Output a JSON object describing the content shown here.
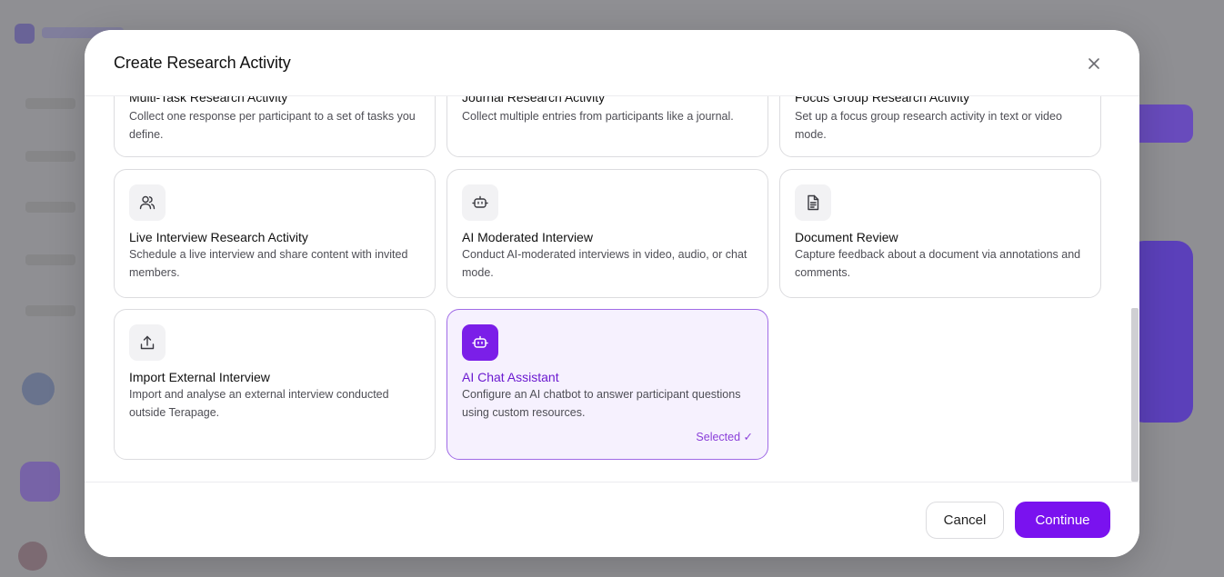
{
  "modal": {
    "title": "Create Research Activity"
  },
  "activities": [
    {
      "title": "Multi-Task Research Activity",
      "description": "Collect one response per participant to a set of tasks you define.",
      "icon": "tasks-icon"
    },
    {
      "title": "Journal Research Activity",
      "description": "Collect multiple entries from participants like a journal.",
      "icon": "journal-icon"
    },
    {
      "title": "Focus Group Research Activity",
      "description": "Set up a focus group research activity in text or video mode.",
      "icon": "focus-group-icon"
    },
    {
      "title": "Live Interview Research Activity",
      "description": "Schedule a live interview and share content with invited members.",
      "icon": "users-icon"
    },
    {
      "title": "AI Moderated Interview",
      "description": "Conduct AI-moderated interviews in video, audio, or chat mode.",
      "icon": "bot-icon"
    },
    {
      "title": "Document Review",
      "description": "Capture feedback about a document via annotations and comments.",
      "icon": "document-icon"
    },
    {
      "title": "Import External Interview",
      "description": "Import and analyse an external interview conducted outside Terapage.",
      "icon": "upload-icon"
    },
    {
      "title": "AI Chat Assistant",
      "description": "Configure an AI chatbot to answer participant questions using custom resources.",
      "icon": "bot-icon",
      "selected": true,
      "selected_label": "Selected ✓"
    }
  ],
  "footer": {
    "cancel_label": "Cancel",
    "continue_label": "Continue"
  },
  "colors": {
    "accent": "#7a12ef",
    "selected_border": "#a06be6",
    "selected_background": "#f6f1fe",
    "selected_text": "#6b1ad0"
  }
}
